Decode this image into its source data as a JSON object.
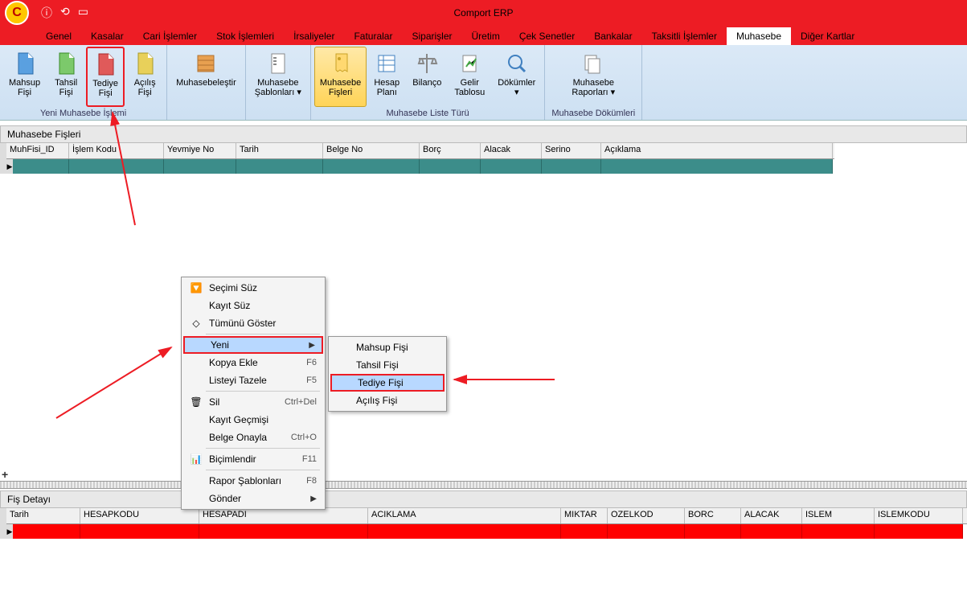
{
  "app_title": "Comport ERP",
  "menu_tabs": [
    "Genel",
    "Kasalar",
    "Cari İşlemler",
    "Stok İşlemleri",
    "İrsaliyeler",
    "Faturalar",
    "Siparişler",
    "Üretim",
    "Çek Senetler",
    "Bankalar",
    "Taksitli İşlemler",
    "Muhasebe",
    "Diğer Kartlar"
  ],
  "ribbon": {
    "group1_label": "Yeni Muhasebe İşlemi",
    "mahsup": "Mahsup\nFişi",
    "tahsil": "Tahsil\nFişi",
    "tediye": "Tediye\nFişi",
    "acilis": "Açılış\nFişi",
    "muhasebele": "Muhasebeleştir",
    "sablon": "Muhasebe\nŞablonları ▾",
    "group2_label": "Muhasebe Liste Türü",
    "fisleri": "Muhasebe\nFişleri",
    "hesap": "Hesap\nPlanı",
    "bilanco": "Bilanço",
    "gelir": "Gelir\nTablosu",
    "dokumler": "Dökümler\n▾",
    "group3_label": "Muhasebe Dökümleri",
    "raporlari": "Muhasebe\nRaporları ▾"
  },
  "upper_panel_title": "Muhasebe Fişleri",
  "upper_cols": [
    "MuhFisi_ID",
    "İşlem Kodu",
    "Yevmiye No",
    "Tarih",
    "Belge No",
    "Borç",
    "Alacak",
    "Serino",
    "Açıklama"
  ],
  "lower_panel_title": "Fiş Detayı",
  "lower_cols": [
    "Tarih",
    "HESAPKODU",
    "HESAPADI",
    "ACIKLAMA",
    "MIKTAR",
    "OZELKOD",
    "BORC",
    "ALACAK",
    "ISLEM",
    "ISLEMKODU"
  ],
  "ctx": {
    "secimi": "Seçimi Süz",
    "kayit": "Kayıt Süz",
    "tumunu": "Tümünü Göster",
    "yeni": "Yeni",
    "kopya": "Kopya Ekle",
    "kopya_hint": "F6",
    "listeyi": "Listeyi Tazele",
    "listeyi_hint": "F5",
    "sil": "Sil",
    "sil_hint": "Ctrl+Del",
    "gecmis": "Kayıt Geçmişi",
    "onayla": "Belge Onayla",
    "onayla_hint": "Ctrl+O",
    "bicim": "Biçimlendir",
    "bicim_hint": "F11",
    "rapor": "Rapor Şablonları",
    "rapor_hint": "F8",
    "gonder": "Gönder"
  },
  "submenu": {
    "mahsup": "Mahsup Fişi",
    "tahsil": "Tahsil Fişi",
    "tediye": "Tediye Fişi",
    "acilis": "Açılış Fişi"
  }
}
